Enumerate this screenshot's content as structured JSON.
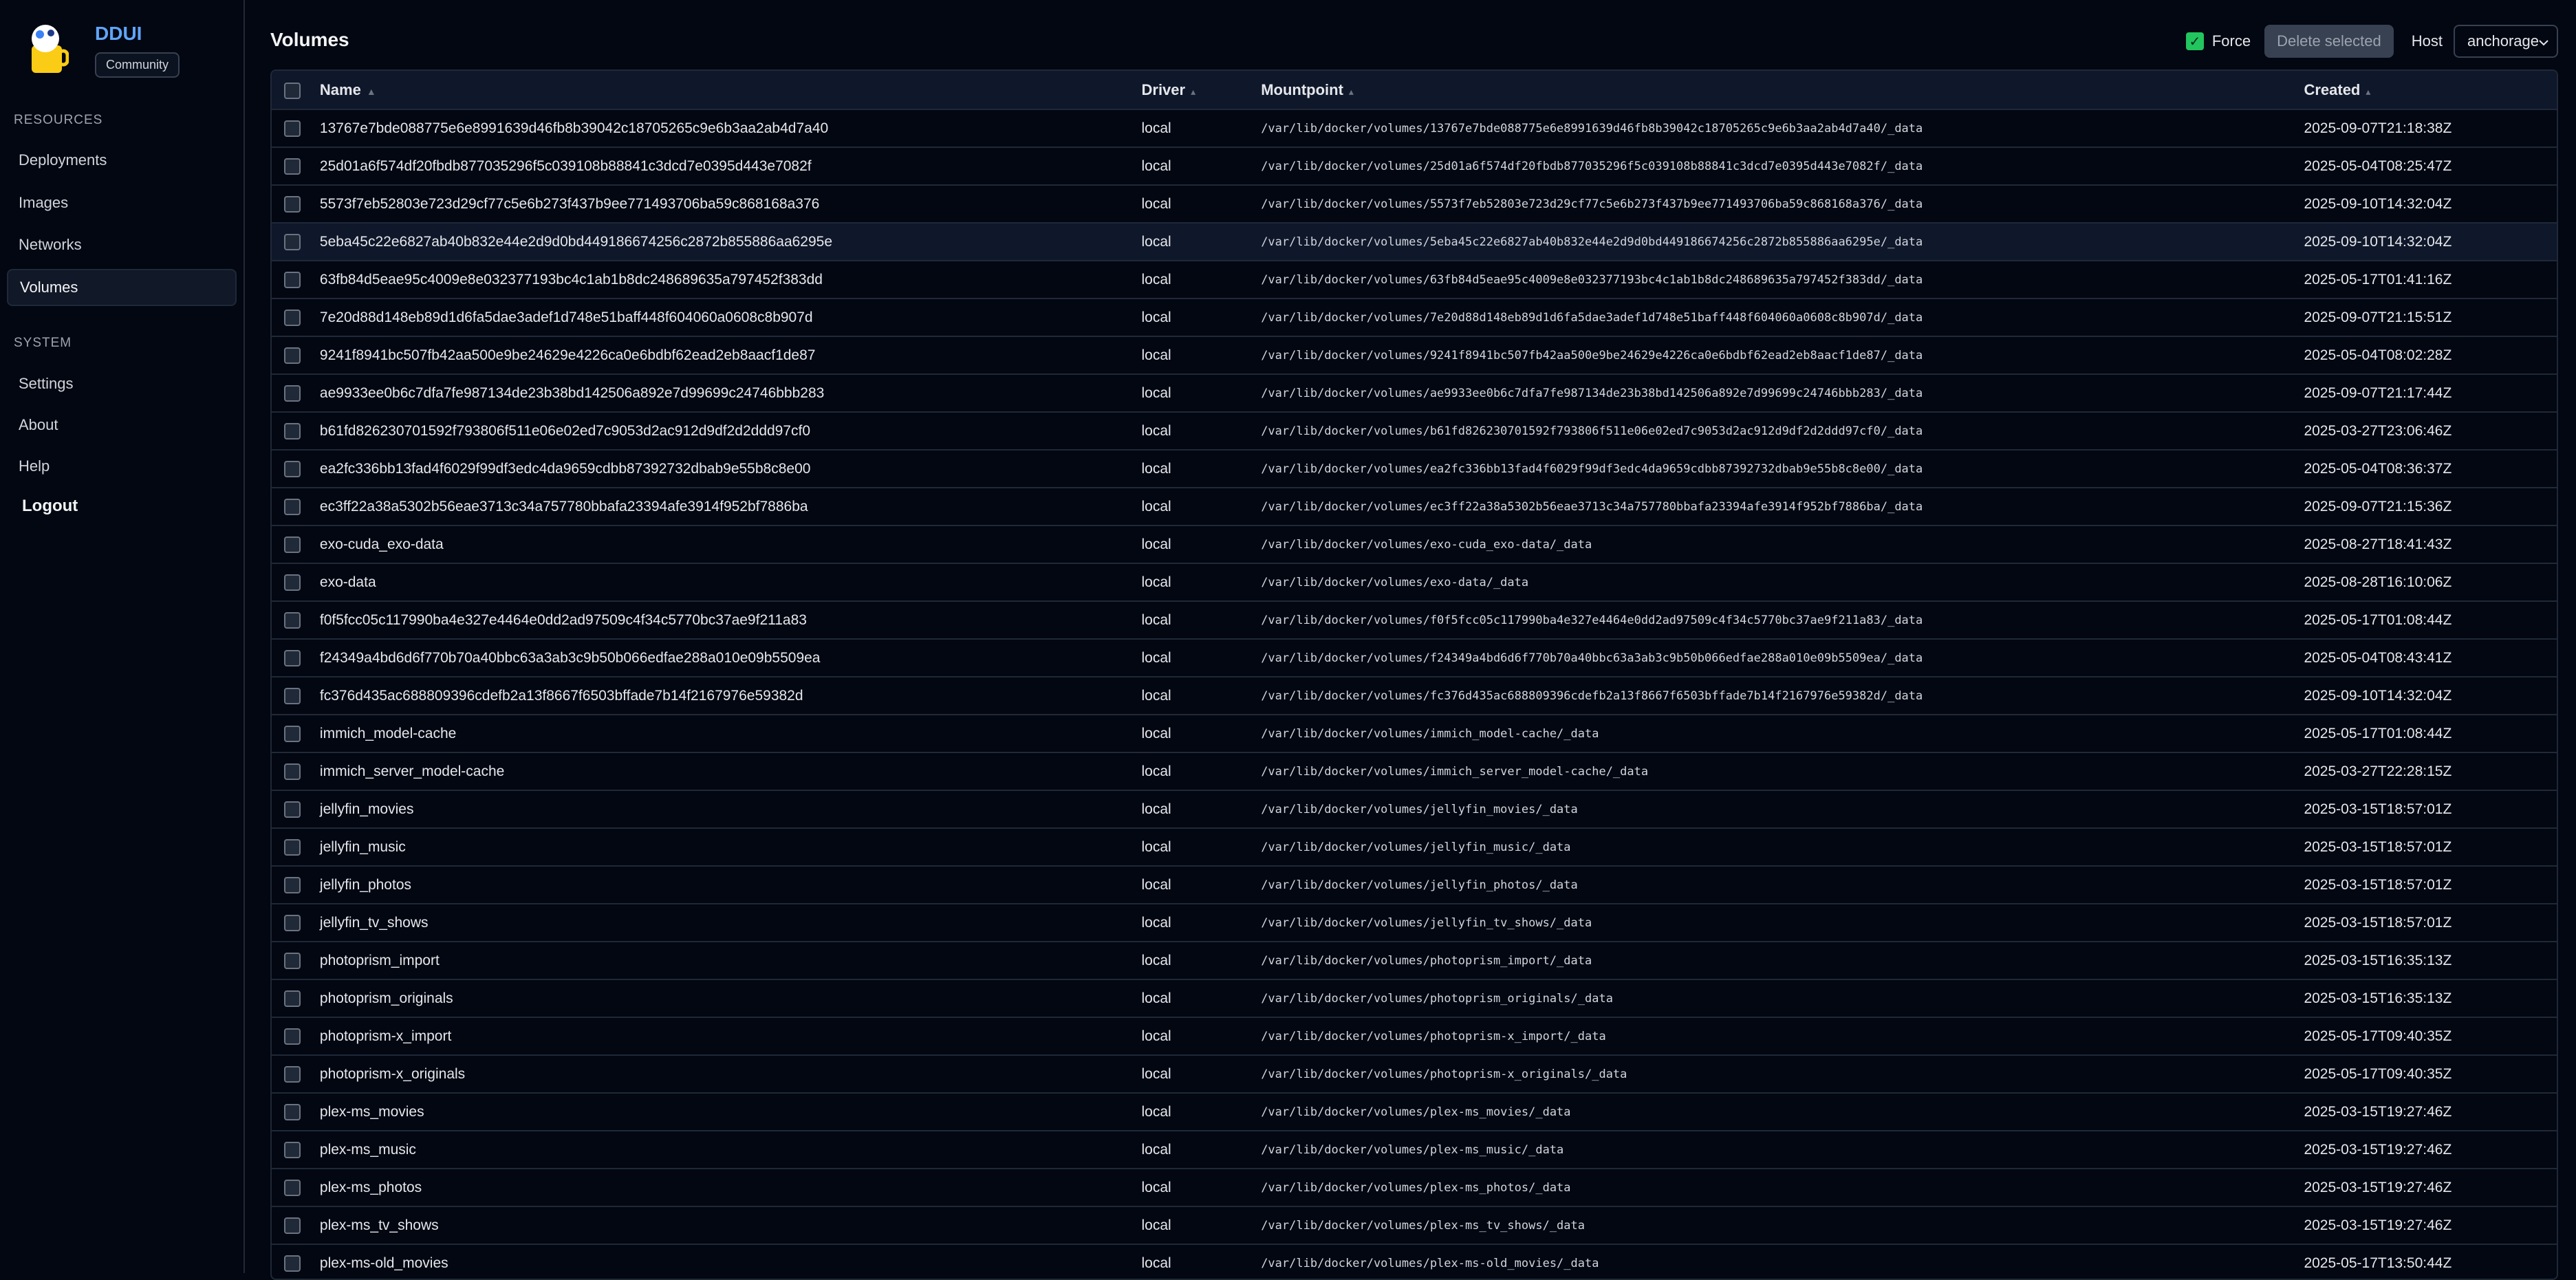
{
  "app": {
    "name": "DDUI",
    "edition": "Community"
  },
  "sidebar": {
    "resources_label": "RESOURCES",
    "system_label": "SYSTEM",
    "resources": [
      {
        "label": "Deployments"
      },
      {
        "label": "Images"
      },
      {
        "label": "Networks"
      },
      {
        "label": "Volumes"
      }
    ],
    "system": [
      {
        "label": "Settings"
      },
      {
        "label": "About"
      },
      {
        "label": "Help"
      }
    ],
    "logout_label": "Logout",
    "active_item": "Volumes"
  },
  "header": {
    "title": "Volumes",
    "force_label": "Force",
    "force_checked": true,
    "delete_label": "Delete selected",
    "host_label": "Host",
    "host_value": "anchorage"
  },
  "colors": {
    "accent": "#60a5fa",
    "force_checkbox": "#22c55e",
    "background": "#030712"
  },
  "table": {
    "columns": {
      "name": "Name",
      "driver": "Driver",
      "mountpoint": "Mountpoint",
      "created": "Created"
    },
    "rows": [
      {
        "name": "13767e7bde088775e6e8991639d46fb8b39042c18705265c9e6b3aa2ab4d7a40",
        "driver": "local",
        "mountpoint": "/var/lib/docker/volumes/13767e7bde088775e6e8991639d46fb8b39042c18705265c9e6b3aa2ab4d7a40/_data",
        "created": "2025-09-07T21:18:38Z"
      },
      {
        "name": "25d01a6f574df20fbdb877035296f5c039108b88841c3dcd7e0395d443e7082f",
        "driver": "local",
        "mountpoint": "/var/lib/docker/volumes/25d01a6f574df20fbdb877035296f5c039108b88841c3dcd7e0395d443e7082f/_data",
        "created": "2025-05-04T08:25:47Z"
      },
      {
        "name": "5573f7eb52803e723d29cf77c5e6b273f437b9ee771493706ba59c868168a376",
        "driver": "local",
        "mountpoint": "/var/lib/docker/volumes/5573f7eb52803e723d29cf77c5e6b273f437b9ee771493706ba59c868168a376/_data",
        "created": "2025-09-10T14:32:04Z"
      },
      {
        "name": "5eba45c22e6827ab40b832e44e2d9d0bd449186674256c2872b855886aa6295e",
        "driver": "local",
        "mountpoint": "/var/lib/docker/volumes/5eba45c22e6827ab40b832e44e2d9d0bd449186674256c2872b855886aa6295e/_data",
        "created": "2025-09-10T14:32:04Z"
      },
      {
        "name": "63fb84d5eae95c4009e8e032377193bc4c1ab1b8dc248689635a797452f383dd",
        "driver": "local",
        "mountpoint": "/var/lib/docker/volumes/63fb84d5eae95c4009e8e032377193bc4c1ab1b8dc248689635a797452f383dd/_data",
        "created": "2025-05-17T01:41:16Z"
      },
      {
        "name": "7e20d88d148eb89d1d6fa5dae3adef1d748e51baff448f604060a0608c8b907d",
        "driver": "local",
        "mountpoint": "/var/lib/docker/volumes/7e20d88d148eb89d1d6fa5dae3adef1d748e51baff448f604060a0608c8b907d/_data",
        "created": "2025-09-07T21:15:51Z"
      },
      {
        "name": "9241f8941bc507fb42aa500e9be24629e4226ca0e6bdbf62ead2eb8aacf1de87",
        "driver": "local",
        "mountpoint": "/var/lib/docker/volumes/9241f8941bc507fb42aa500e9be24629e4226ca0e6bdbf62ead2eb8aacf1de87/_data",
        "created": "2025-05-04T08:02:28Z"
      },
      {
        "name": "ae9933ee0b6c7dfa7fe987134de23b38bd142506a892e7d99699c24746bbb283",
        "driver": "local",
        "mountpoint": "/var/lib/docker/volumes/ae9933ee0b6c7dfa7fe987134de23b38bd142506a892e7d99699c24746bbb283/_data",
        "created": "2025-09-07T21:17:44Z"
      },
      {
        "name": "b61fd826230701592f793806f511e06e02ed7c9053d2ac912d9df2d2ddd97cf0",
        "driver": "local",
        "mountpoint": "/var/lib/docker/volumes/b61fd826230701592f793806f511e06e02ed7c9053d2ac912d9df2d2ddd97cf0/_data",
        "created": "2025-03-27T23:06:46Z"
      },
      {
        "name": "ea2fc336bb13fad4f6029f99df3edc4da9659cdbb87392732dbab9e55b8c8e00",
        "driver": "local",
        "mountpoint": "/var/lib/docker/volumes/ea2fc336bb13fad4f6029f99df3edc4da9659cdbb87392732dbab9e55b8c8e00/_data",
        "created": "2025-05-04T08:36:37Z"
      },
      {
        "name": "ec3ff22a38a5302b56eae3713c34a757780bbafa23394afe3914f952bf7886ba",
        "driver": "local",
        "mountpoint": "/var/lib/docker/volumes/ec3ff22a38a5302b56eae3713c34a757780bbafa23394afe3914f952bf7886ba/_data",
        "created": "2025-09-07T21:15:36Z"
      },
      {
        "name": "exo-cuda_exo-data",
        "driver": "local",
        "mountpoint": "/var/lib/docker/volumes/exo-cuda_exo-data/_data",
        "created": "2025-08-27T18:41:43Z"
      },
      {
        "name": "exo-data",
        "driver": "local",
        "mountpoint": "/var/lib/docker/volumes/exo-data/_data",
        "created": "2025-08-28T16:10:06Z"
      },
      {
        "name": "f0f5fcc05c117990ba4e327e4464e0dd2ad97509c4f34c5770bc37ae9f211a83",
        "driver": "local",
        "mountpoint": "/var/lib/docker/volumes/f0f5fcc05c117990ba4e327e4464e0dd2ad97509c4f34c5770bc37ae9f211a83/_data",
        "created": "2025-05-17T01:08:44Z"
      },
      {
        "name": "f24349a4bd6d6f770b70a40bbc63a3ab3c9b50b066edfae288a010e09b5509ea",
        "driver": "local",
        "mountpoint": "/var/lib/docker/volumes/f24349a4bd6d6f770b70a40bbc63a3ab3c9b50b066edfae288a010e09b5509ea/_data",
        "created": "2025-05-04T08:43:41Z"
      },
      {
        "name": "fc376d435ac688809396cdefb2a13f8667f6503bffade7b14f2167976e59382d",
        "driver": "local",
        "mountpoint": "/var/lib/docker/volumes/fc376d435ac688809396cdefb2a13f8667f6503bffade7b14f2167976e59382d/_data",
        "created": "2025-09-10T14:32:04Z"
      },
      {
        "name": "immich_model-cache",
        "driver": "local",
        "mountpoint": "/var/lib/docker/volumes/immich_model-cache/_data",
        "created": "2025-05-17T01:08:44Z"
      },
      {
        "name": "immich_server_model-cache",
        "driver": "local",
        "mountpoint": "/var/lib/docker/volumes/immich_server_model-cache/_data",
        "created": "2025-03-27T22:28:15Z"
      },
      {
        "name": "jellyfin_movies",
        "driver": "local",
        "mountpoint": "/var/lib/docker/volumes/jellyfin_movies/_data",
        "created": "2025-03-15T18:57:01Z"
      },
      {
        "name": "jellyfin_music",
        "driver": "local",
        "mountpoint": "/var/lib/docker/volumes/jellyfin_music/_data",
        "created": "2025-03-15T18:57:01Z"
      },
      {
        "name": "jellyfin_photos",
        "driver": "local",
        "mountpoint": "/var/lib/docker/volumes/jellyfin_photos/_data",
        "created": "2025-03-15T18:57:01Z"
      },
      {
        "name": "jellyfin_tv_shows",
        "driver": "local",
        "mountpoint": "/var/lib/docker/volumes/jellyfin_tv_shows/_data",
        "created": "2025-03-15T18:57:01Z"
      },
      {
        "name": "photoprism_import",
        "driver": "local",
        "mountpoint": "/var/lib/docker/volumes/photoprism_import/_data",
        "created": "2025-03-15T16:35:13Z"
      },
      {
        "name": "photoprism_originals",
        "driver": "local",
        "mountpoint": "/var/lib/docker/volumes/photoprism_originals/_data",
        "created": "2025-03-15T16:35:13Z"
      },
      {
        "name": "photoprism-x_import",
        "driver": "local",
        "mountpoint": "/var/lib/docker/volumes/photoprism-x_import/_data",
        "created": "2025-05-17T09:40:35Z"
      },
      {
        "name": "photoprism-x_originals",
        "driver": "local",
        "mountpoint": "/var/lib/docker/volumes/photoprism-x_originals/_data",
        "created": "2025-05-17T09:40:35Z"
      },
      {
        "name": "plex-ms_movies",
        "driver": "local",
        "mountpoint": "/var/lib/docker/volumes/plex-ms_movies/_data",
        "created": "2025-03-15T19:27:46Z"
      },
      {
        "name": "plex-ms_music",
        "driver": "local",
        "mountpoint": "/var/lib/docker/volumes/plex-ms_music/_data",
        "created": "2025-03-15T19:27:46Z"
      },
      {
        "name": "plex-ms_photos",
        "driver": "local",
        "mountpoint": "/var/lib/docker/volumes/plex-ms_photos/_data",
        "created": "2025-03-15T19:27:46Z"
      },
      {
        "name": "plex-ms_tv_shows",
        "driver": "local",
        "mountpoint": "/var/lib/docker/volumes/plex-ms_tv_shows/_data",
        "created": "2025-03-15T19:27:46Z"
      },
      {
        "name": "plex-ms-old_movies",
        "driver": "local",
        "mountpoint": "/var/lib/docker/volumes/plex-ms-old_movies/_data",
        "created": "2025-05-17T13:50:44Z"
      }
    ]
  }
}
